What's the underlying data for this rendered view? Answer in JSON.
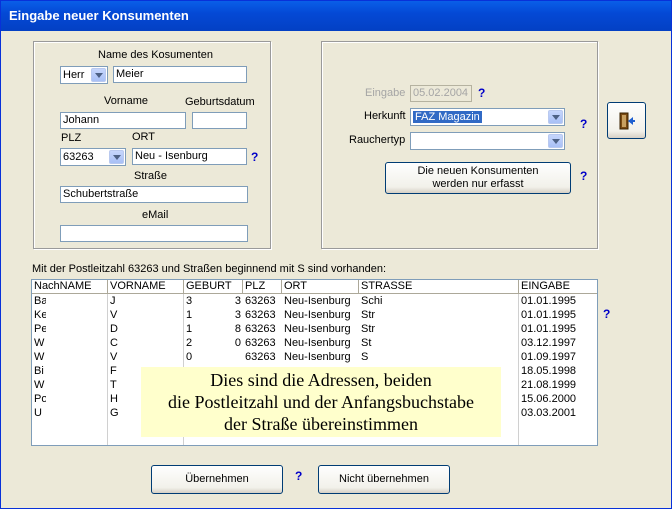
{
  "window": {
    "title": "Eingabe neuer Konsumenten"
  },
  "left_panel": {
    "name_label": "Name des Kosumenten",
    "salutation": "Herr",
    "lastname": "Meier",
    "firstname_label": "Vorname",
    "birthdate_label": "Geburtsdatum",
    "firstname": "Johann",
    "birthdate": "",
    "plz_label": "PLZ",
    "ort_label": "ORT",
    "plz": "63263",
    "ort": "Neu - Isenburg",
    "street_label": "Straße",
    "street": "Schubertstraße",
    "email_label": "eMail",
    "email": ""
  },
  "right_panel": {
    "entry_label": "Eingabe",
    "entry_date": "05.02.2004",
    "origin_label": "Herkunft",
    "origin": "FAZ Magazin",
    "smoker_label": "Rauchertyp",
    "smoker": "",
    "info_button_line1": "Die neuen Konsumenten",
    "info_button_line2": "werden nur erfasst"
  },
  "help_mark": "?",
  "list": {
    "caption": "Mit der Postleitzahl 63263 und Straßen beginnend mit S sind vorhanden:",
    "headers": [
      "NachNAME",
      "VORNAME",
      "GEBURT",
      "PLZ",
      "ORT",
      "STRASSE",
      "EINGABE"
    ],
    "rows": [
      [
        "Ba",
        "J",
        "3",
        "63263",
        "Neu-Isenburg",
        "Schi",
        "01.01.1995"
      ],
      [
        "Ke",
        "V",
        "1",
        "63263",
        "Neu-Isenburg",
        "Str",
        "01.01.1995"
      ],
      [
        "Pe",
        "D",
        "1",
        "63263",
        "Neu-Isenburg",
        "Str",
        "01.01.1995"
      ],
      [
        "W",
        "C",
        "2",
        "63263",
        "Neu-Isenburg",
        "St",
        "03.12.1997"
      ],
      [
        "W",
        "V",
        "0",
        "63263",
        "Neu-Isenburg",
        "S",
        "01.09.1997"
      ],
      [
        "Bi",
        "F",
        "",
        "",
        "",
        "",
        "18.05.1998"
      ],
      [
        "W",
        "T",
        "",
        "",
        "",
        "",
        "21.08.1999"
      ],
      [
        "Po",
        "H",
        "",
        "",
        "",
        "",
        "15.06.2000"
      ],
      [
        "U",
        "G",
        "",
        "",
        "",
        "",
        "03.03.2001"
      ]
    ],
    "geburt_extra": [
      "3",
      "3",
      "8",
      "0"
    ]
  },
  "tooltip": {
    "line1": "Dies sind die Adressen, beiden",
    "line2": "die Postleitzahl und der Anfangsbuchstabe",
    "line3": "der Straße übereinstimmen"
  },
  "buttons": {
    "accept": "Übernehmen",
    "reject": "Nicht übernehmen"
  },
  "icons": {
    "exit": "exit-door-icon"
  },
  "colors": {
    "titlebar": "#0449d6",
    "help": "#0000c8",
    "tooltip_bg": "#ffffcc"
  }
}
